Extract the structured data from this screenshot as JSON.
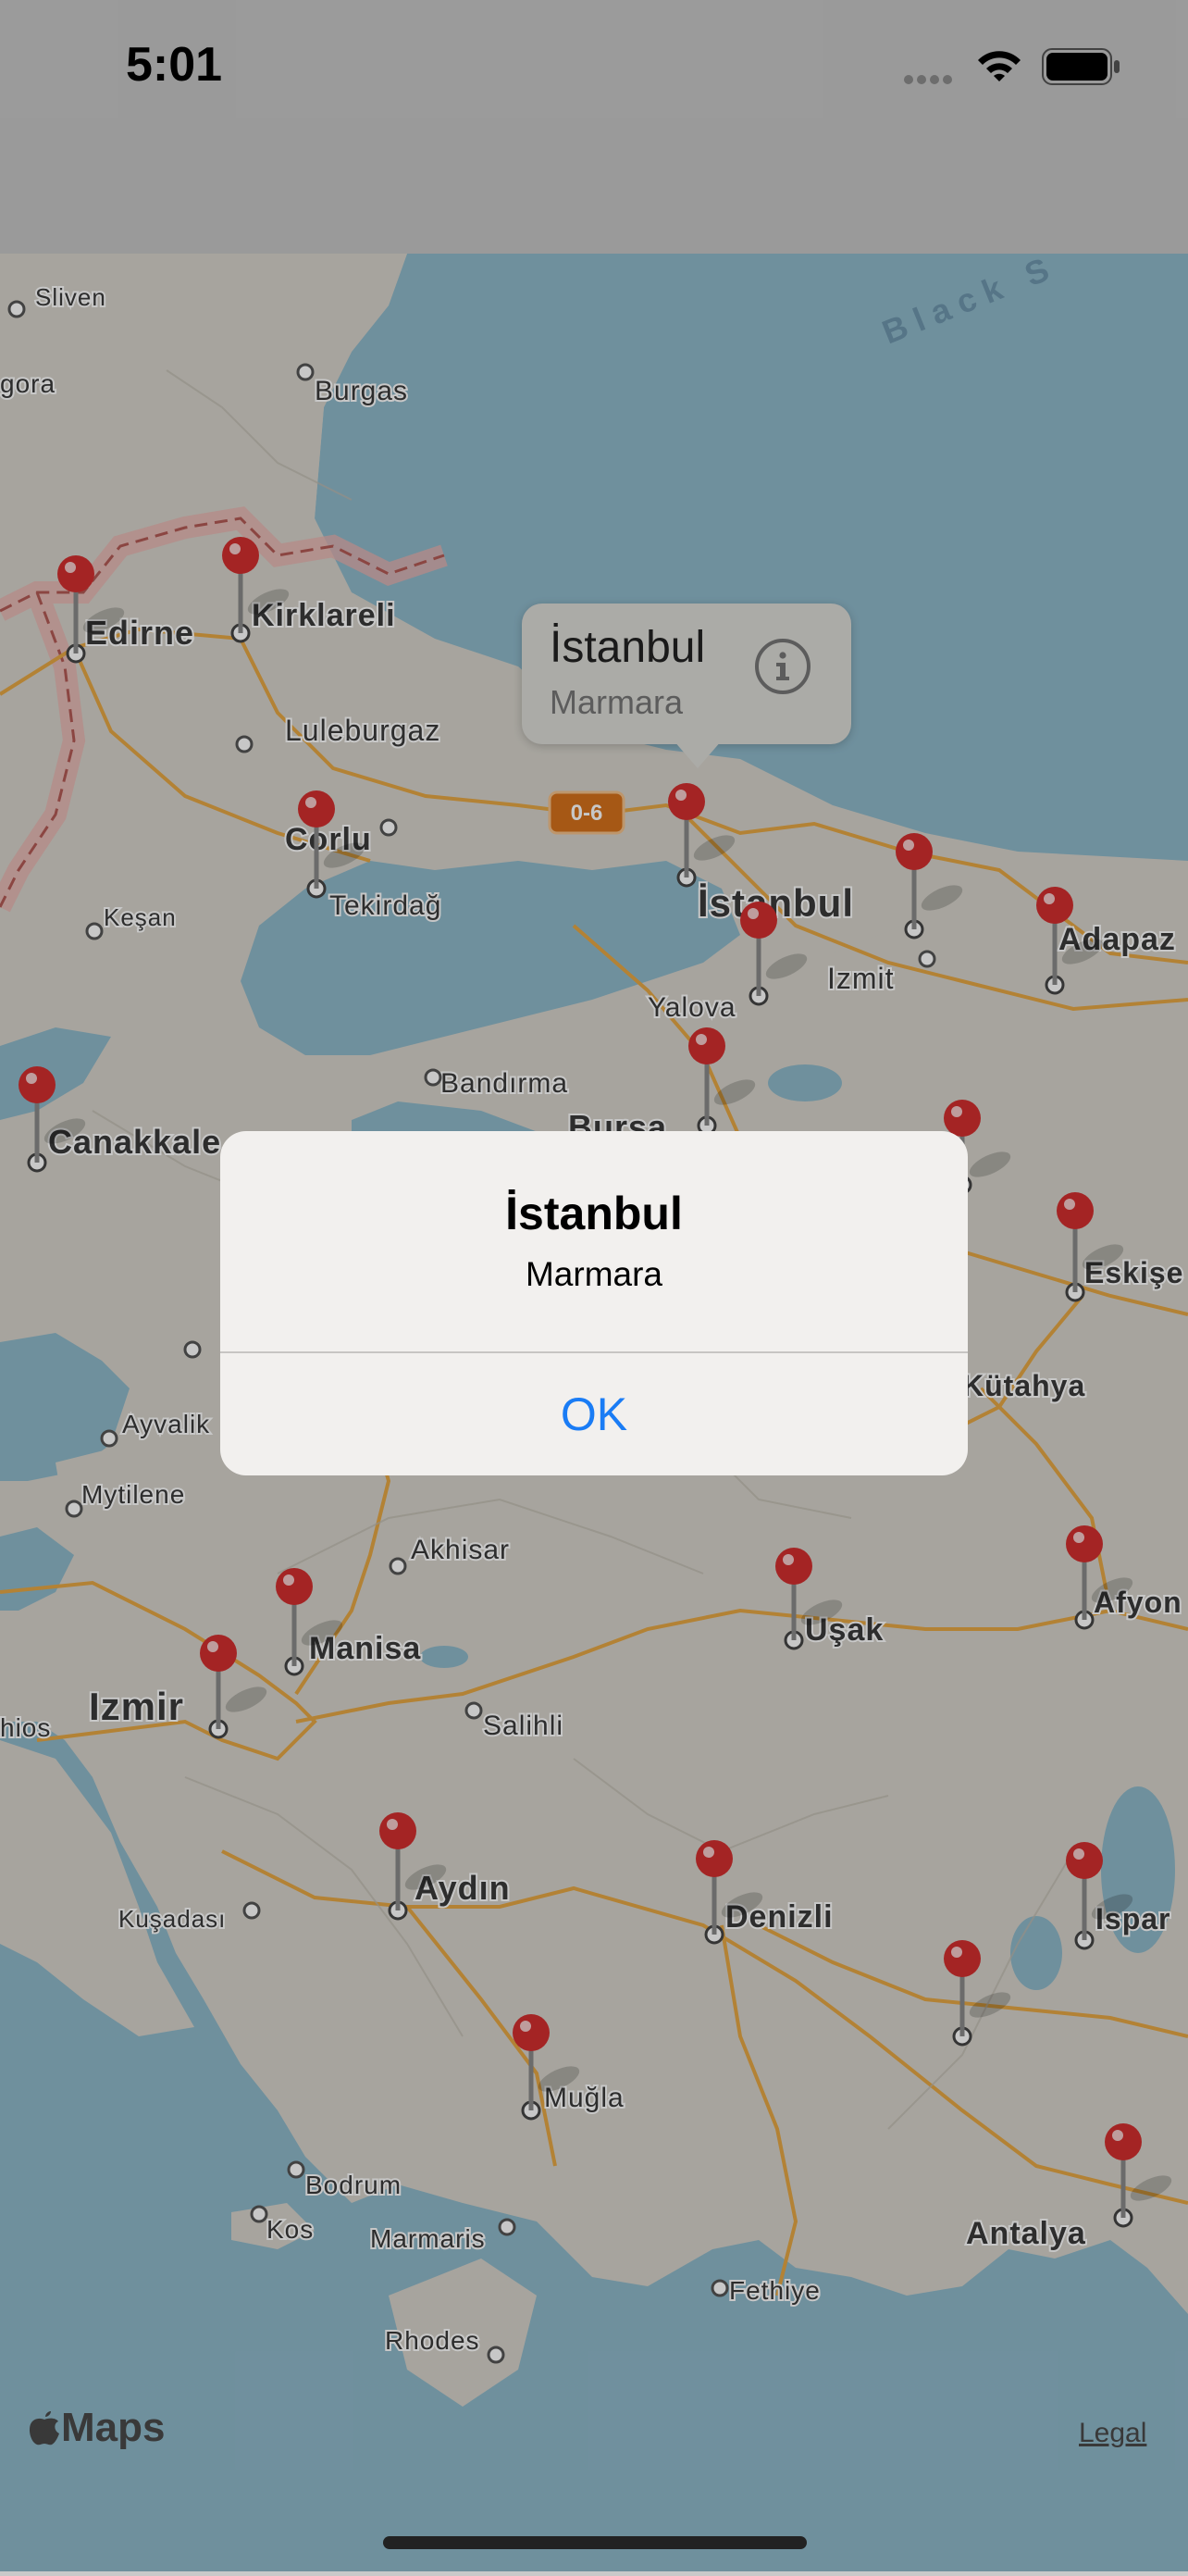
{
  "status_bar": {
    "time": "5:01"
  },
  "map": {
    "sea_label": "Black S",
    "cities": [
      {
        "name": "Sliven"
      },
      {
        "name": "gora"
      },
      {
        "name": "Burgas"
      },
      {
        "name": "Edirne"
      },
      {
        "name": "Kirklareli"
      },
      {
        "name": "Luleburgaz"
      },
      {
        "name": "Corlu"
      },
      {
        "name": "Tekirdağ"
      },
      {
        "name": "Keşan"
      },
      {
        "name": "İstanbul"
      },
      {
        "name": "Izmit"
      },
      {
        "name": "Adapaz"
      },
      {
        "name": "Yalova"
      },
      {
        "name": "Bandırma"
      },
      {
        "name": "Bursa"
      },
      {
        "name": "Canakkale"
      },
      {
        "name": "Eskişe"
      },
      {
        "name": "Kütahya"
      },
      {
        "name": "Ayvalik"
      },
      {
        "name": "Mytilene"
      },
      {
        "name": "Akhisar"
      },
      {
        "name": "Manisa"
      },
      {
        "name": "Uşak"
      },
      {
        "name": "Afyon"
      },
      {
        "name": "Izmir"
      },
      {
        "name": "hios"
      },
      {
        "name": "Salihli"
      },
      {
        "name": "Aydın"
      },
      {
        "name": "Denizli"
      },
      {
        "name": "Ispar"
      },
      {
        "name": "Kuşadası"
      },
      {
        "name": "Muğla"
      },
      {
        "name": "Bodrum"
      },
      {
        "name": "Kos"
      },
      {
        "name": "Marmaris"
      },
      {
        "name": "Fethiye"
      },
      {
        "name": "Antalya"
      },
      {
        "name": "Rhodes"
      }
    ],
    "road_shield": "0-6",
    "pin_color": "#d32f2f"
  },
  "callout": {
    "title": "İstanbul",
    "subtitle": "Marmara",
    "icon": "info-icon"
  },
  "alert": {
    "title": "İstanbul",
    "message": "Marmara",
    "ok_label": "OK",
    "ok_color": "#1a7cf5"
  },
  "footer": {
    "maps_label": "Maps",
    "legal_label": "Legal"
  }
}
